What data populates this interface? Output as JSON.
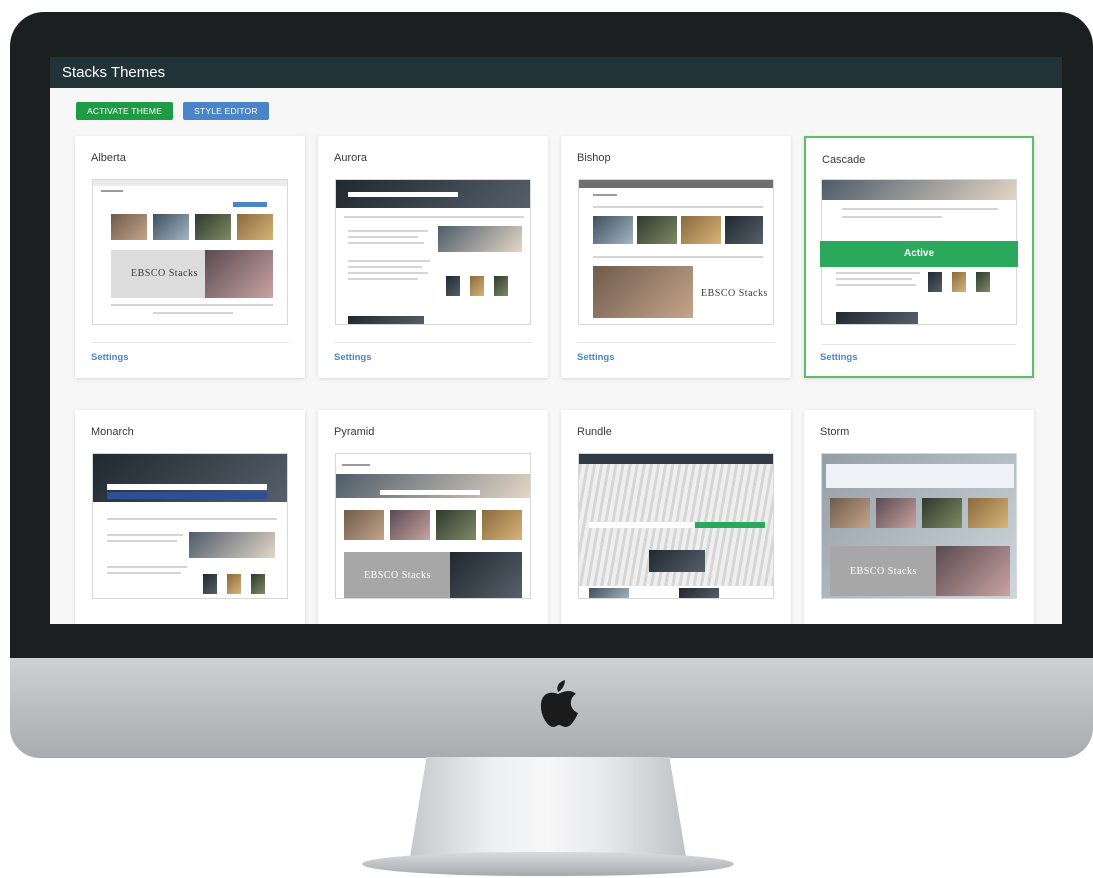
{
  "app": {
    "title": "Stacks Themes"
  },
  "toolbar": {
    "activate_label": "ACTIVATE THEME",
    "style_editor_label": "STYLE EDITOR"
  },
  "colors": {
    "title_bar": "#223337",
    "activate_button": "#1f9a45",
    "style_editor_button": "#4a86c7",
    "active_border": "#5cbf6b",
    "active_ribbon": "#2aa85b",
    "link": "#4a86c7"
  },
  "themes": [
    {
      "name": "Alberta",
      "settings_label": "Settings",
      "active": false,
      "logo_text": "EBSCO Stacks"
    },
    {
      "name": "Aurora",
      "settings_label": "Settings",
      "active": false
    },
    {
      "name": "Bishop",
      "settings_label": "Settings",
      "active": false,
      "logo_text": "EBSCO Stacks"
    },
    {
      "name": "Cascade",
      "settings_label": "Settings",
      "active": true,
      "badge": "Active"
    },
    {
      "name": "Monarch",
      "active": false
    },
    {
      "name": "Pyramid",
      "active": false,
      "logo_text": "EBSCO Stacks"
    },
    {
      "name": "Rundle",
      "active": false
    },
    {
      "name": "Storm",
      "active": false,
      "logo_text": "EBSCO Stacks"
    }
  ],
  "device": {
    "logo_icon": "apple-logo-icon"
  }
}
